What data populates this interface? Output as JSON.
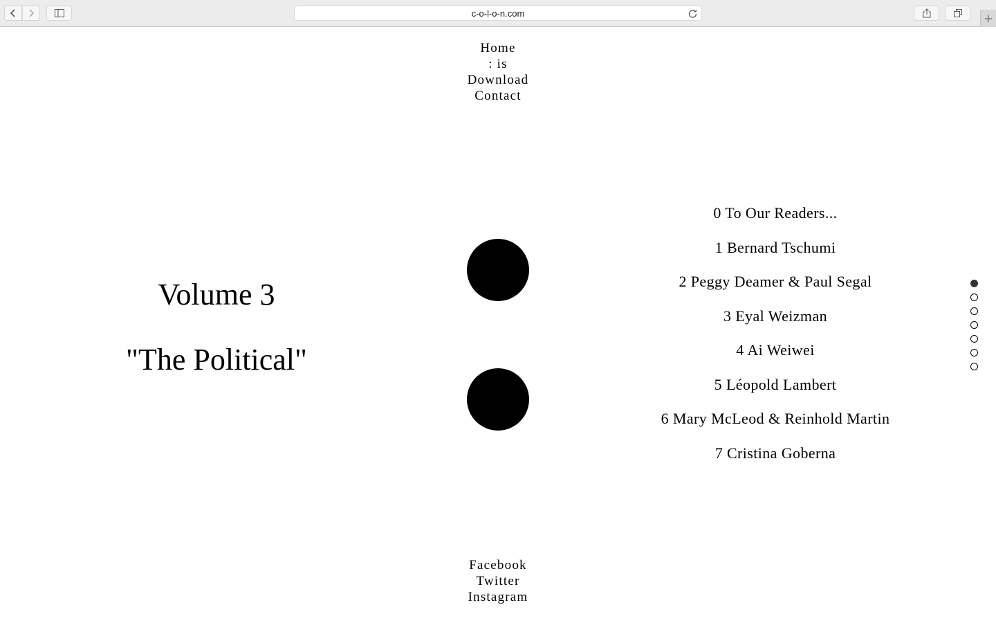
{
  "browser": {
    "url": "c-o-l-o-n.com",
    "icons": [
      "back-icon",
      "forward-icon",
      "sidebar-icon",
      "reload-icon",
      "share-icon",
      "tabs-icon",
      "plus-icon"
    ]
  },
  "menu": {
    "items": [
      "Home",
      ": is",
      "Download",
      "Contact"
    ]
  },
  "hero": {
    "volume": "Volume 3",
    "theme": "\"The Political\""
  },
  "articles": [
    "0 To Our Readers...",
    "1 Bernard Tschumi",
    "2 Peggy Deamer & Paul Segal",
    "3 Eyal Weizman",
    "4 Ai Weiwei",
    "5 Léopold Lambert",
    "6 Mary McLeod & Reinhold Martin",
    "7 Cristina Goberna"
  ],
  "pager": {
    "count": 7,
    "active_index": 0
  },
  "social": {
    "items": [
      "Facebook",
      "Twitter",
      "Instagram"
    ]
  },
  "colors": {
    "text": "#000000",
    "background": "#ffffff",
    "chrome": "#ececec"
  }
}
